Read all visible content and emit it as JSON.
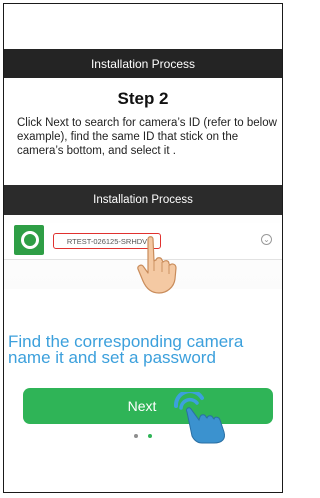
{
  "header": {
    "title": "Installation Process"
  },
  "step": {
    "title": "Step 2",
    "instruction": "Click Next to search for camera’s ID (refer to below example), find the same ID that stick on the camera’s bottom, and select it ."
  },
  "example": {
    "header_title": "Installation Process",
    "device_id": "RTEST-026125-SRHDV",
    "icon": "camera-icon",
    "hand_icon": "pointing-hand-icon"
  },
  "caption": {
    "line1": "Find the corresponding camera",
    "line2": "name it and set a password"
  },
  "next_button": {
    "label": "Next",
    "hand_icon": "tap-hand-icon"
  },
  "pager": {
    "total": 2,
    "current": 2
  },
  "colors": {
    "accent_green": "#2fb457",
    "caption_blue": "#3ca0dc",
    "header_dark": "#242424",
    "highlight_red": "#e0312f"
  }
}
